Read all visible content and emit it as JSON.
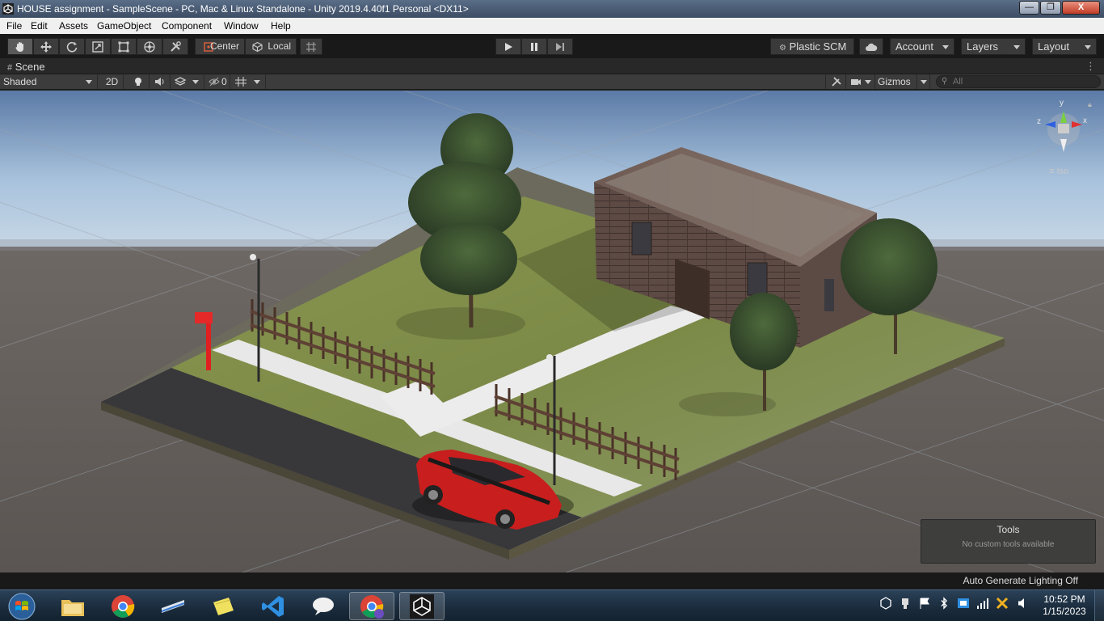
{
  "window": {
    "title": "HOUSE  assignment - SampleScene - PC, Mac & Linux Standalone - Unity 2019.4.40f1 Personal <DX11>",
    "minimize_glyph": "—",
    "maximize_glyph": "❐",
    "close_glyph": "X"
  },
  "menu": {
    "items": [
      "File",
      "Edit",
      "Assets",
      "GameObject",
      "Component",
      "Window",
      "Help"
    ]
  },
  "toolbar": {
    "transform_tools": [
      "hand-tool",
      "move-tool",
      "rotate-tool",
      "scale-tool",
      "rect-tool",
      "transform-tool",
      "custom-tool"
    ],
    "pivot_label": "Center",
    "space_label": "Local",
    "collab_label": "Plastic SCM",
    "account_label": "Account",
    "layers_label": "Layers",
    "layout_label": "Layout"
  },
  "scene_tab": {
    "label": "Scene",
    "draw_mode": "Shaded",
    "mode_2d": "2D",
    "hidden_count": "0",
    "gizmos_label": "Gizmos",
    "search_placeholder": "All"
  },
  "gizmo": {
    "y": "y",
    "x": "x",
    "z": "z",
    "projection_label": "≡ Iso"
  },
  "tools_overlay": {
    "title": "Tools",
    "message": "No custom tools available"
  },
  "status": {
    "lighting": "Auto Generate Lighting Off"
  },
  "taskbar": {
    "time": "10:52 PM",
    "date": "1/15/2023",
    "apps": [
      "windows-start",
      "file-explorer",
      "chrome",
      "scanner",
      "sticky-notes",
      "visual-studio-code",
      "messaging",
      "chrome-profile",
      "unity"
    ]
  },
  "colors": {
    "editor_bg": "#191919",
    "grass": "#7a8a48",
    "road": "#3a3a3d",
    "car": "#c81e1e",
    "house_wall": "#5a4640"
  }
}
